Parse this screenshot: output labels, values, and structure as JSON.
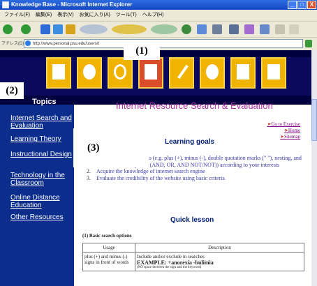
{
  "window": {
    "title": "Knowledge Base - Microsoft Internet Explorer",
    "controls": [
      "_",
      "□",
      "X"
    ]
  },
  "menubar": [
    "ファイル(F)",
    "編集(E)",
    "表示(V)",
    "お気に入り(A)",
    "ツール(T)",
    "ヘルプ(H)"
  ],
  "address": {
    "label": "アドレス(D)",
    "url": "http://www.personal.psu.edu/users/t",
    "go_label": "移動"
  },
  "annotations": [
    "(1)",
    "(2)",
    "(3)"
  ],
  "banner": {
    "icons": [
      "building-icon",
      "whistle-icon",
      "wheel-icon",
      "document-icon",
      "pen-icon",
      "globe-icon",
      "person-computer-icon",
      "clipboard-icon"
    ]
  },
  "sidebar": {
    "header": "Topics",
    "items": [
      "Internet Search and Evaluation",
      "Learning Theory",
      "Instructional Design",
      "Technology in the Classroom",
      "Online Distance Education",
      "Other Resources"
    ]
  },
  "main": {
    "page_title": "Internet Resource Search & Evaluation",
    "links": [
      "Go to Exercise",
      "Home",
      "Sitemap"
    ],
    "learning_goals_heading": "Learning goals",
    "goals": [
      "Use basic search options (e.g. plus (+), minus (-), double quotation marks (\" \"), nesting, and Boolean search options (AND, OR, AND NOT/NOT)) according to your interests",
      "Acquire the knowledge of internet search engine",
      "Evaluate the credibility of the website using basic criteria"
    ],
    "quick_lesson_heading": "Quick lesson",
    "basic_search_options": "(1) Basic search options",
    "table": {
      "headers": [
        "Usage",
        "Description"
      ],
      "row1": {
        "usage": "plus (+) and minus (-) signs in front of words",
        "desc_main": "Include and/or exclude in searches",
        "desc_example": "EXAMPLE: +anorexia -bulimia",
        "desc_note": "(NO space between the sign and the keyword)"
      }
    }
  },
  "colors": {
    "sidebar_bg": "#0b2d8c",
    "banner_bg": "#00003f",
    "icon_tile": "#f0b400",
    "title_text": "#b030a8",
    "heading_text": "#001f7a"
  }
}
